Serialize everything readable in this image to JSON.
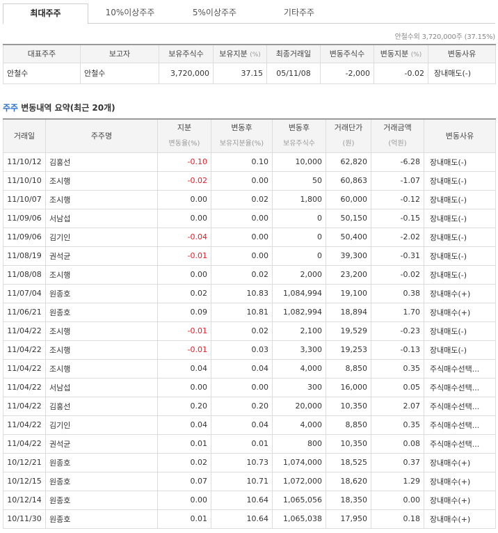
{
  "tabs": [
    "최대주주",
    "10%이상주주",
    "5%이상주주",
    "기타주주"
  ],
  "summary": "안철수외 3,720,000주 (37.15%)",
  "top_table": {
    "headers": [
      "대표주주",
      "보고자",
      "보유주식수",
      "보유지분",
      "(%)",
      "최종거래일",
      "변동주식수",
      "변동지분",
      "(%)",
      "변동사유"
    ],
    "row": {
      "rep": "안철수",
      "reporter": "안철수",
      "shares": "3,720,000",
      "stake": "37.15",
      "last_date": "05/11/08",
      "chg_shares": "-2,000",
      "chg_stake": "-0.02",
      "reason": "장내매도(-)"
    }
  },
  "section": {
    "accent": "주주",
    "title": " 변동내역 요약(최근 20개)"
  },
  "changes": {
    "headers": {
      "date": "거래일",
      "name": "주주명",
      "chg_top": "지분",
      "chg_bottom": "변동율(%)",
      "after_stake_top": "변동후",
      "after_stake_bottom": "보유지분율(%)",
      "after_shares_top": "변동후",
      "after_shares_bottom": "보유주식수",
      "price_top": "거래단가",
      "price_bottom": "(원)",
      "amount_top": "거래금액",
      "amount_bottom": "(억원)",
      "reason": "변동사유"
    },
    "rows": [
      {
        "date": "11/10/12",
        "name": "김홍선",
        "chg": "-0.10",
        "stake": "0.10",
        "shares": "10,000",
        "price": "62,820",
        "amount": "-6.28",
        "reason": "장내매도(-)",
        "neg": true
      },
      {
        "date": "11/10/10",
        "name": "조시행",
        "chg": "-0.02",
        "stake": "0.00",
        "shares": "50",
        "price": "60,863",
        "amount": "-1.07",
        "reason": "장내매도(-)",
        "neg": true
      },
      {
        "date": "11/10/07",
        "name": "조시행",
        "chg": "0.00",
        "stake": "0.02",
        "shares": "1,800",
        "price": "60,000",
        "amount": "-0.12",
        "reason": "장내매도(-)",
        "neg": false
      },
      {
        "date": "11/09/06",
        "name": "서남섭",
        "chg": "0.00",
        "stake": "0.00",
        "shares": "0",
        "price": "50,150",
        "amount": "-0.15",
        "reason": "장내매도(-)",
        "neg": false
      },
      {
        "date": "11/09/06",
        "name": "김기인",
        "chg": "-0.04",
        "stake": "0.00",
        "shares": "0",
        "price": "50,400",
        "amount": "-2.02",
        "reason": "장내매도(-)",
        "neg": true
      },
      {
        "date": "11/08/19",
        "name": "권석균",
        "chg": "-0.01",
        "stake": "0.00",
        "shares": "0",
        "price": "39,300",
        "amount": "-0.31",
        "reason": "장내매도(-)",
        "neg": true
      },
      {
        "date": "11/08/08",
        "name": "조시행",
        "chg": "0.00",
        "stake": "0.02",
        "shares": "2,000",
        "price": "23,200",
        "amount": "-0.02",
        "reason": "장내매도(-)",
        "neg": false
      },
      {
        "date": "11/07/04",
        "name": "원종호",
        "chg": "0.02",
        "stake": "10.83",
        "shares": "1,084,994",
        "price": "19,100",
        "amount": "0.38",
        "reason": "장내매수(+)",
        "neg": false
      },
      {
        "date": "11/06/21",
        "name": "원종호",
        "chg": "0.09",
        "stake": "10.81",
        "shares": "1,082,994",
        "price": "18,894",
        "amount": "1.70",
        "reason": "장내매수(+)",
        "neg": false
      },
      {
        "date": "11/04/22",
        "name": "조시행",
        "chg": "-0.01",
        "stake": "0.02",
        "shares": "2,100",
        "price": "19,529",
        "amount": "-0.23",
        "reason": "장내매도(-)",
        "neg": true
      },
      {
        "date": "11/04/22",
        "name": "조시행",
        "chg": "-0.01",
        "stake": "0.03",
        "shares": "3,300",
        "price": "19,253",
        "amount": "-0.13",
        "reason": "장내매도(-)",
        "neg": true
      },
      {
        "date": "11/04/22",
        "name": "조시행",
        "chg": "0.04",
        "stake": "0.04",
        "shares": "4,000",
        "price": "8,850",
        "amount": "0.35",
        "reason": "주식매수선택...",
        "neg": false
      },
      {
        "date": "11/04/22",
        "name": "서남섭",
        "chg": "0.00",
        "stake": "0.00",
        "shares": "300",
        "price": "16,000",
        "amount": "0.05",
        "reason": "주식매수선택...",
        "neg": false
      },
      {
        "date": "11/04/22",
        "name": "김홍선",
        "chg": "0.20",
        "stake": "0.20",
        "shares": "20,000",
        "price": "10,350",
        "amount": "2.07",
        "reason": "주식매수선택...",
        "neg": false
      },
      {
        "date": "11/04/22",
        "name": "김기인",
        "chg": "0.04",
        "stake": "0.04",
        "shares": "4,000",
        "price": "8,850",
        "amount": "0.35",
        "reason": "주식매수선택...",
        "neg": false
      },
      {
        "date": "11/04/22",
        "name": "권석균",
        "chg": "0.01",
        "stake": "0.01",
        "shares": "800",
        "price": "10,350",
        "amount": "0.08",
        "reason": "주식매수선택...",
        "neg": false
      },
      {
        "date": "10/12/21",
        "name": "원종호",
        "chg": "0.02",
        "stake": "10.73",
        "shares": "1,074,000",
        "price": "18,525",
        "amount": "0.37",
        "reason": "장내매수(+)",
        "neg": false
      },
      {
        "date": "10/12/15",
        "name": "원종호",
        "chg": "0.07",
        "stake": "10.71",
        "shares": "1,072,000",
        "price": "18,620",
        "amount": "1.29",
        "reason": "장내매수(+)",
        "neg": false
      },
      {
        "date": "10/12/14",
        "name": "원종호",
        "chg": "0.00",
        "stake": "10.64",
        "shares": "1,065,056",
        "price": "18,350",
        "amount": "0.00",
        "reason": "장내매수(+)",
        "neg": false
      },
      {
        "date": "10/11/30",
        "name": "원종호",
        "chg": "0.01",
        "stake": "10.64",
        "shares": "1,065,038",
        "price": "17,950",
        "amount": "0.18",
        "reason": "장내매수(+)",
        "neg": false
      }
    ]
  },
  "colors": {
    "negative": "#e0202a",
    "accent": "#2c6fc9"
  }
}
